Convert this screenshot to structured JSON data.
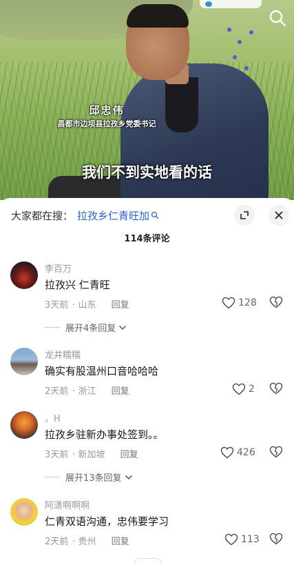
{
  "video": {
    "caption_name": "邱忠伟",
    "caption_title": "昌都市边坝县拉孜乡党委书记",
    "subtitle": "我们不到实地看的话"
  },
  "sheet": {
    "search_prefix": "大家都在搜：",
    "search_term": "拉孜乡仁青旺加",
    "comment_count": "114条评论"
  },
  "comments": [
    {
      "username": "李百万",
      "text": "拉孜兴 仁青旺",
      "time": "3天前",
      "location": "山东",
      "reply": "回复",
      "likes": "128",
      "expand": "展开4条回复"
    },
    {
      "username": "龙井糯糯",
      "text": "确实有股温州口音哈哈哈",
      "time": "2天前",
      "location": "浙江",
      "reply": "回复",
      "likes": "2"
    },
    {
      "username": "。H",
      "text": "拉孜乡驻新办事处签到。。",
      "time": "3天前",
      "location": "新加坡",
      "reply": "回复",
      "likes": "426",
      "expand": "展开13条回复"
    },
    {
      "username": "阿潇啊啊啊",
      "text": "仁青双语沟通，忠伟要学习",
      "time": "2天前",
      "location": "贵州",
      "reply": "回复",
      "likes": "113"
    }
  ],
  "icons": {
    "video_search": "search-icon",
    "expand": "expand-arrow-icon",
    "close": "close-icon",
    "like": "heart-icon",
    "dislike": "broken-heart-icon"
  }
}
